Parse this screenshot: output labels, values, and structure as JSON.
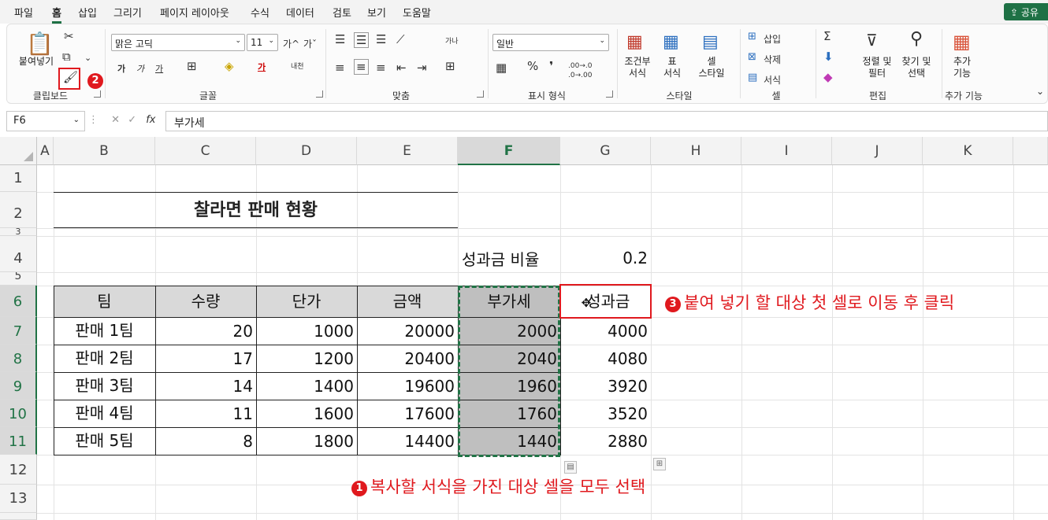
{
  "menu": {
    "tabs": [
      "파일",
      "홈",
      "삽입",
      "그리기",
      "페이지 레이아웃",
      "수식",
      "데이터",
      "검토",
      "보기",
      "도움말"
    ],
    "active": "홈",
    "share": "공유"
  },
  "ribbon": {
    "clipboard": {
      "paste": "붙여넣기",
      "label": "클립보드"
    },
    "font": {
      "name": "맑은 고딕",
      "size": "11",
      "label": "글꼴",
      "bold": "가",
      "italic": "가",
      "underline": "가",
      "grow": "가^",
      "shrink": "가ˇ",
      "color_char": "가",
      "phonetic": "내천"
    },
    "align": {
      "label": "맞춤",
      "wrap": "가나",
      "merge": "⊞"
    },
    "number": {
      "format": "일반",
      "label": "표시 형식",
      "percent": "%",
      "comma": "❜",
      "inc": ".00→.0",
      "dec": ".0→.00"
    },
    "styles": {
      "cond": "조건부\n서식",
      "table": "표\n서식",
      "cell": "셀\n스타일",
      "label": "스타일"
    },
    "cells": {
      "insert": "삽입",
      "delete": "삭제",
      "format": "서식",
      "label": "셀"
    },
    "editing": {
      "sort": "정렬 및\n필터",
      "find": "찾기 및\n선택",
      "label": "편집",
      "sigma": "Σ"
    },
    "addins": {
      "btn": "추가\n기능",
      "label": "추가 기능"
    }
  },
  "formula_bar": {
    "cell_ref": "F6",
    "fx": "fx",
    "value": "부가세"
  },
  "columns": [
    "A",
    "B",
    "C",
    "D",
    "E",
    "F",
    "G",
    "H",
    "I",
    "J",
    "K"
  ],
  "rows": [
    "1",
    "2",
    "3",
    "4",
    "5",
    "6",
    "7",
    "8",
    "9",
    "10",
    "11",
    "12",
    "13"
  ],
  "sheet": {
    "title": "찰라면 판매 현황",
    "ratio_label": "성과금 비율",
    "ratio_value": "0.2",
    "headers": [
      "팀",
      "수량",
      "단가",
      "금액",
      "부가세",
      "성과금"
    ],
    "rows": [
      [
        "판매 1팀",
        "20",
        "1000",
        "20000",
        "2000",
        "4000"
      ],
      [
        "판매 2팀",
        "17",
        "1200",
        "20400",
        "2040",
        "4080"
      ],
      [
        "판매 3팀",
        "14",
        "1400",
        "19600",
        "1960",
        "3920"
      ],
      [
        "판매 4팀",
        "11",
        "1600",
        "17600",
        "1760",
        "3520"
      ],
      [
        "판매 5팀",
        "8",
        "1800",
        "14400",
        "1440",
        "2880"
      ]
    ]
  },
  "annotations": {
    "step1_num": "1",
    "step1": "복사할 서식을 가진 대상 셀을 모두 선택",
    "step2_num": "2",
    "step3_num": "3",
    "step3": "붙여 넣기 할 대상 첫 셀로 이동 후 클릭"
  },
  "colors": {
    "accent": "#217346",
    "annotation": "#e0191e"
  }
}
